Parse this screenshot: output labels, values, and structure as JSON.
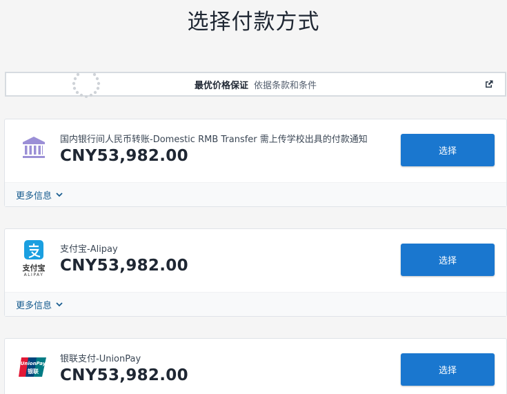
{
  "page_title": "选择付款方式",
  "guarantee": {
    "label_bold": "最优价格保证",
    "label_light": "依据条款和条件",
    "icon": "external-link-icon"
  },
  "methods": [
    {
      "name": "国内银行间人民币转账-Domestic RMB Transfer 需上传学校出具的付款通知",
      "price": "CNY53,982.00",
      "select_label": "选择",
      "more_label": "更多信息",
      "icon": "bank-icon"
    },
    {
      "name": "支付宝-Alipay",
      "price": "CNY53,982.00",
      "select_label": "选择",
      "more_label": "更多信息",
      "icon": "alipay-logo",
      "logo_text_cn": "支付宝",
      "logo_text_en": "ALIPAY"
    },
    {
      "name": "银联支付-UnionPay",
      "price": "CNY53,982.00",
      "select_label": "选择",
      "icon": "unionpay-logo",
      "logo_text_en": "UnionPay",
      "logo_text_cn": "银联"
    }
  ],
  "colors": {
    "primary": "#1a77cf",
    "link": "#175c8f",
    "bank_icon": "#9b8fd6",
    "alipay": "#1a9fe0",
    "unionpay_red": "#e21836",
    "unionpay_blue": "#00447c",
    "unionpay_green": "#007b84"
  }
}
